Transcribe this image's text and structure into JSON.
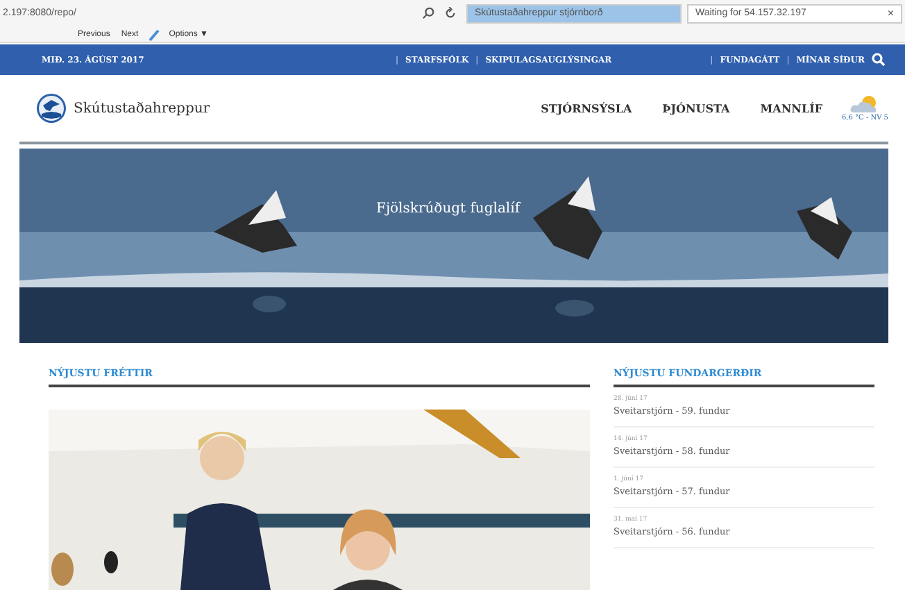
{
  "browser": {
    "address": "2.197:8080/repo/",
    "tabs": [
      {
        "label": "Skútustaðahreppur stjórnborð",
        "selected": true
      },
      {
        "label": "Waiting for 54.157.32.197",
        "selected": false,
        "close": "×"
      }
    ],
    "find_buttons": [
      "Previous",
      "Next"
    ],
    "options": "Options ▼"
  },
  "top_bar": {
    "date": "MIÐ. 23. ÁGÚST 2017",
    "center": [
      {
        "kind": "separator",
        "text": "|"
      },
      {
        "kind": "link",
        "text": "STARFSFÓLK"
      },
      {
        "kind": "separator",
        "text": "|"
      },
      {
        "kind": "link",
        "text": "SKIPULAGSAUGLÝSINGAR"
      }
    ],
    "right": [
      {
        "kind": "separator",
        "text": "|"
      },
      {
        "kind": "link",
        "text": "FUNDAGÁTT"
      },
      {
        "kind": "separator",
        "text": "|"
      },
      {
        "kind": "link",
        "text": "MÍNAR SÍÐUR"
      }
    ]
  },
  "header": {
    "site_name": "Skútustaðahreppur",
    "nav": [
      "STJÓRNSÝSLA",
      "ÞJÓNUSTA",
      "MANNLÍF"
    ],
    "weather": "6,6 °C - NV 5"
  },
  "hero": {
    "caption": "Fjölskrúðugt fuglalíf"
  },
  "news": {
    "title": "NÝJUSTU FRÉTTIR"
  },
  "minutes": {
    "title": "NÝJUSTU FUNDARGERÐIR",
    "items": [
      {
        "date": "28. júní 17",
        "title": "Sveitarstjórn - 59. fundur"
      },
      {
        "date": "14. júní 17",
        "title": "Sveitarstjórn - 58. fundur"
      },
      {
        "date": "1. júní 17",
        "title": "Sveitarstjórn - 57. fundur"
      },
      {
        "date": "31. maí 17",
        "title": "Sveitarstjórn - 56. fundur"
      }
    ]
  }
}
